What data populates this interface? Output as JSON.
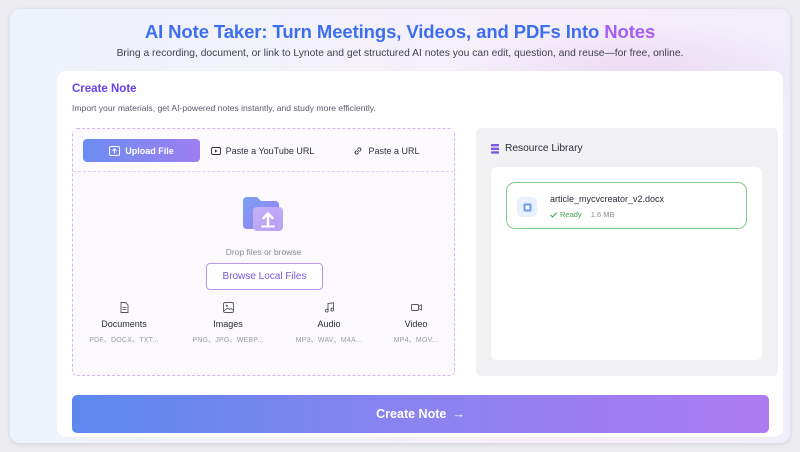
{
  "hero": {
    "title_main": "AI Note Taker: Turn Meetings, Videos, and PDFs Into ",
    "title_accent": "Notes",
    "subtitle": "Bring a recording, document, or link to Lynote and get structured AI notes you can edit, question, and reuse—for free, online."
  },
  "card": {
    "title": "Create Note",
    "description": "Import your materials, get AI-powered notes instantly, and study more efficiently."
  },
  "tabs": [
    {
      "label": "Upload File",
      "icon": "upload-icon",
      "active": true
    },
    {
      "label": "Paste a YouTube URL",
      "icon": "youtube-icon",
      "active": false
    },
    {
      "label": "Paste a URL",
      "icon": "link-icon",
      "active": false
    }
  ],
  "upload": {
    "drop_text": "Drop files or browse",
    "browse_label": "Browse Local Files",
    "types": [
      {
        "name": "Documents",
        "ext": "PDF、DOCX、TXT...",
        "icon": "document-icon"
      },
      {
        "name": "Images",
        "ext": "PNG、JPG、WEBP...",
        "icon": "image-icon"
      },
      {
        "name": "Audio",
        "ext": "MP3、WAV、M4A...",
        "icon": "music-icon"
      },
      {
        "name": "Video",
        "ext": "MP4、MOV...",
        "icon": "video-icon"
      }
    ]
  },
  "library": {
    "title": "Resource Library",
    "files": [
      {
        "name": "article_mycvcreator_v2.docx",
        "status": "Ready",
        "size": "1.6 MB"
      }
    ]
  },
  "create_button": {
    "label": "Create Note",
    "arrow": "→"
  },
  "colors": {
    "brand_blue": "#3c6ff0",
    "brand_purple": "#a55ef0",
    "ready_green": "#3fa34d"
  }
}
